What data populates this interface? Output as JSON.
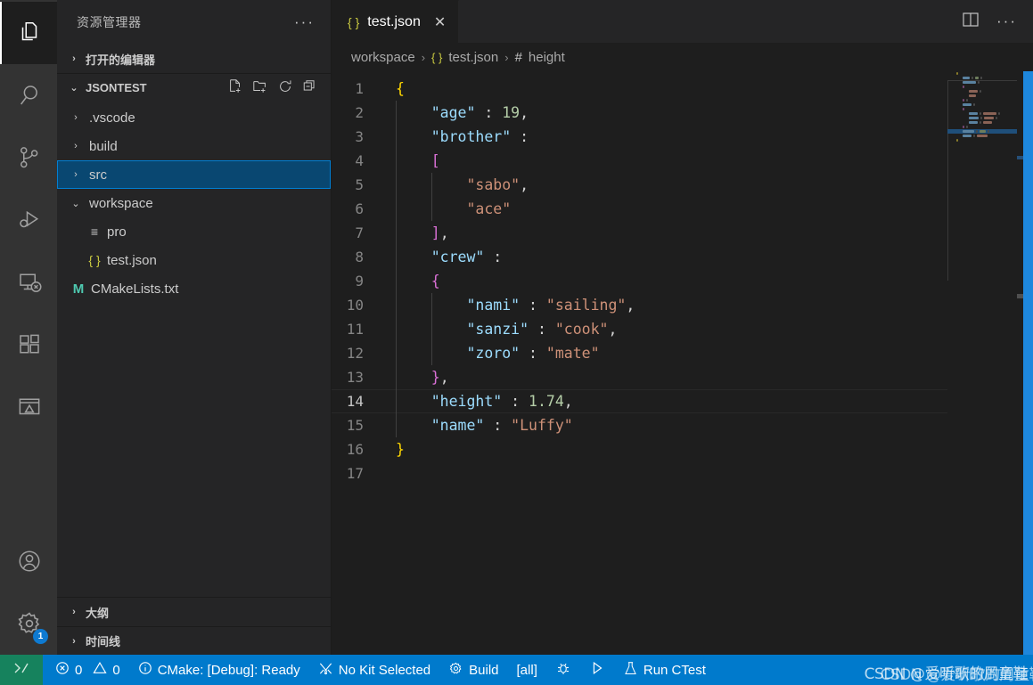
{
  "activity_bar": {
    "items": [
      {
        "name": "explorer",
        "icon": "files-icon",
        "active": true
      },
      {
        "name": "search",
        "icon": "search-icon",
        "active": false
      },
      {
        "name": "source-control",
        "icon": "source-control-icon",
        "active": false
      },
      {
        "name": "run-and-debug",
        "icon": "run-debug-icon",
        "active": false
      },
      {
        "name": "remote-explorer",
        "icon": "remote-explorer-icon",
        "active": false
      },
      {
        "name": "extensions",
        "icon": "extensions-icon",
        "active": false
      },
      {
        "name": "cmake",
        "icon": "cmake-icon",
        "active": false
      }
    ],
    "accounts_icon": "account-icon",
    "settings_icon": "gear-icon",
    "settings_badge": "1"
  },
  "sidebar": {
    "title": "资源管理器",
    "more_actions": "···",
    "open_editors": {
      "label": "打开的编辑器",
      "chevron": "›",
      "expanded": false
    },
    "folder": {
      "label": "JSONTEST",
      "chevron": "⌄",
      "expanded": true,
      "actions": [
        "new-file-icon",
        "new-folder-icon",
        "refresh-icon",
        "collapse-all-icon"
      ]
    },
    "tree": [
      {
        "label": ".vscode",
        "type": "folder",
        "chevron": "›",
        "depth": 1,
        "selected": false
      },
      {
        "label": "build",
        "type": "folder",
        "chevron": "›",
        "depth": 1,
        "selected": false
      },
      {
        "label": "src",
        "type": "folder",
        "chevron": "›",
        "depth": 1,
        "selected": true
      },
      {
        "label": "workspace",
        "type": "folder",
        "chevron": "⌄",
        "depth": 1,
        "selected": false
      },
      {
        "label": "pro",
        "type": "file",
        "icon": "settings-file-icon",
        "depth": 2,
        "selected": false
      },
      {
        "label": "test.json",
        "type": "file",
        "icon": "json-icon",
        "depth": 2,
        "selected": false
      },
      {
        "label": "CMakeLists.txt",
        "type": "file",
        "icon": "cmake-m-icon",
        "depth": 1,
        "selected": false
      }
    ],
    "outline": {
      "label": "大纲",
      "chevron": "›"
    },
    "timeline": {
      "label": "时间线",
      "chevron": "›"
    }
  },
  "editor": {
    "tab": {
      "label": "test.json",
      "icon": "json-icon",
      "close": "✕"
    },
    "actions": {
      "split": "split-editor-icon",
      "more": "···"
    },
    "breadcrumb": [
      {
        "label": "workspace",
        "icon": ""
      },
      {
        "label": "test.json",
        "icon": "json-icon"
      },
      {
        "label": "height",
        "icon": "number-symbol-icon"
      }
    ],
    "breadcrumb_separator": "›",
    "current_line": 14,
    "lines": [
      {
        "num": "1",
        "tokens": [
          {
            "t": "{",
            "c": "b1"
          }
        ]
      },
      {
        "num": "2",
        "tokens": [
          {
            "t": "    ",
            "c": "p"
          },
          {
            "t": "\"age\"",
            "c": "k"
          },
          {
            "t": " : ",
            "c": "p"
          },
          {
            "t": "19",
            "c": "n"
          },
          {
            "t": ",",
            "c": "p"
          }
        ]
      },
      {
        "num": "3",
        "tokens": [
          {
            "t": "    ",
            "c": "p"
          },
          {
            "t": "\"brother\"",
            "c": "k"
          },
          {
            "t": " :",
            "c": "p"
          }
        ]
      },
      {
        "num": "4",
        "tokens": [
          {
            "t": "    ",
            "c": "p"
          },
          {
            "t": "[",
            "c": "b2"
          }
        ]
      },
      {
        "num": "5",
        "tokens": [
          {
            "t": "        ",
            "c": "p"
          },
          {
            "t": "\"sabo\"",
            "c": "s"
          },
          {
            "t": ",",
            "c": "p"
          }
        ]
      },
      {
        "num": "6",
        "tokens": [
          {
            "t": "        ",
            "c": "p"
          },
          {
            "t": "\"ace\"",
            "c": "s"
          }
        ]
      },
      {
        "num": "7",
        "tokens": [
          {
            "t": "    ",
            "c": "p"
          },
          {
            "t": "]",
            "c": "b2"
          },
          {
            "t": ",",
            "c": "p"
          }
        ]
      },
      {
        "num": "8",
        "tokens": [
          {
            "t": "    ",
            "c": "p"
          },
          {
            "t": "\"crew\"",
            "c": "k"
          },
          {
            "t": " :",
            "c": "p"
          }
        ]
      },
      {
        "num": "9",
        "tokens": [
          {
            "t": "    ",
            "c": "p"
          },
          {
            "t": "{",
            "c": "b2"
          }
        ]
      },
      {
        "num": "10",
        "tokens": [
          {
            "t": "        ",
            "c": "p"
          },
          {
            "t": "\"nami\"",
            "c": "k"
          },
          {
            "t": " : ",
            "c": "p"
          },
          {
            "t": "\"sailing\"",
            "c": "s"
          },
          {
            "t": ",",
            "c": "p"
          }
        ]
      },
      {
        "num": "11",
        "tokens": [
          {
            "t": "        ",
            "c": "p"
          },
          {
            "t": "\"sanzi\"",
            "c": "k"
          },
          {
            "t": " : ",
            "c": "p"
          },
          {
            "t": "\"cook\"",
            "c": "s"
          },
          {
            "t": ",",
            "c": "p"
          }
        ]
      },
      {
        "num": "12",
        "tokens": [
          {
            "t": "        ",
            "c": "p"
          },
          {
            "t": "\"zoro\"",
            "c": "k"
          },
          {
            "t": " : ",
            "c": "p"
          },
          {
            "t": "\"mate\"",
            "c": "s"
          }
        ]
      },
      {
        "num": "13",
        "tokens": [
          {
            "t": "    ",
            "c": "p"
          },
          {
            "t": "}",
            "c": "b2"
          },
          {
            "t": ",",
            "c": "p"
          }
        ]
      },
      {
        "num": "14",
        "tokens": [
          {
            "t": "    ",
            "c": "p"
          },
          {
            "t": "\"height\"",
            "c": "k"
          },
          {
            "t": " : ",
            "c": "p"
          },
          {
            "t": "1.74",
            "c": "n"
          },
          {
            "t": ",",
            "c": "p"
          }
        ]
      },
      {
        "num": "15",
        "tokens": [
          {
            "t": "    ",
            "c": "p"
          },
          {
            "t": "\"name\"",
            "c": "k"
          },
          {
            "t": " : ",
            "c": "p"
          },
          {
            "t": "\"Luffy\"",
            "c": "s"
          }
        ]
      },
      {
        "num": "16",
        "tokens": [
          {
            "t": "}",
            "c": "b1"
          }
        ]
      },
      {
        "num": "17",
        "tokens": []
      }
    ]
  },
  "status_bar": {
    "remote_icon": "remote-host-icon",
    "errors_icon": "error-icon",
    "errors": "0",
    "warnings_icon": "warning-icon",
    "warnings": "0",
    "info_icon": "info-icon",
    "cmake_status": "CMake: [Debug]: Ready",
    "kit_icon": "tools-icon",
    "kit": "No Kit Selected",
    "build_icon": "gear-icon",
    "build": "Build",
    "target": "[all]",
    "debug_icon": "bug-icon",
    "launch_icon": "play-icon",
    "ctest_icon": "flask-icon",
    "ctest": "Run CTest"
  },
  "watermark": {
    "line1": "CSDN @爱听歌的周童鞋",
    "line2": "CSDN @爱听歌的周童鞋"
  },
  "colors": {
    "status_bar": "#007acc",
    "remote": "#16825d",
    "selection": "#094771",
    "accent": "#007fd4",
    "editor_bg": "#1e1e1e",
    "sidebar_bg": "#252526",
    "activity_bg": "#333333",
    "json_key": "#9cdcfe",
    "json_string": "#ce9178",
    "json_number": "#b5cea8",
    "bracket1": "#ffd700",
    "bracket2": "#da70d6"
  }
}
